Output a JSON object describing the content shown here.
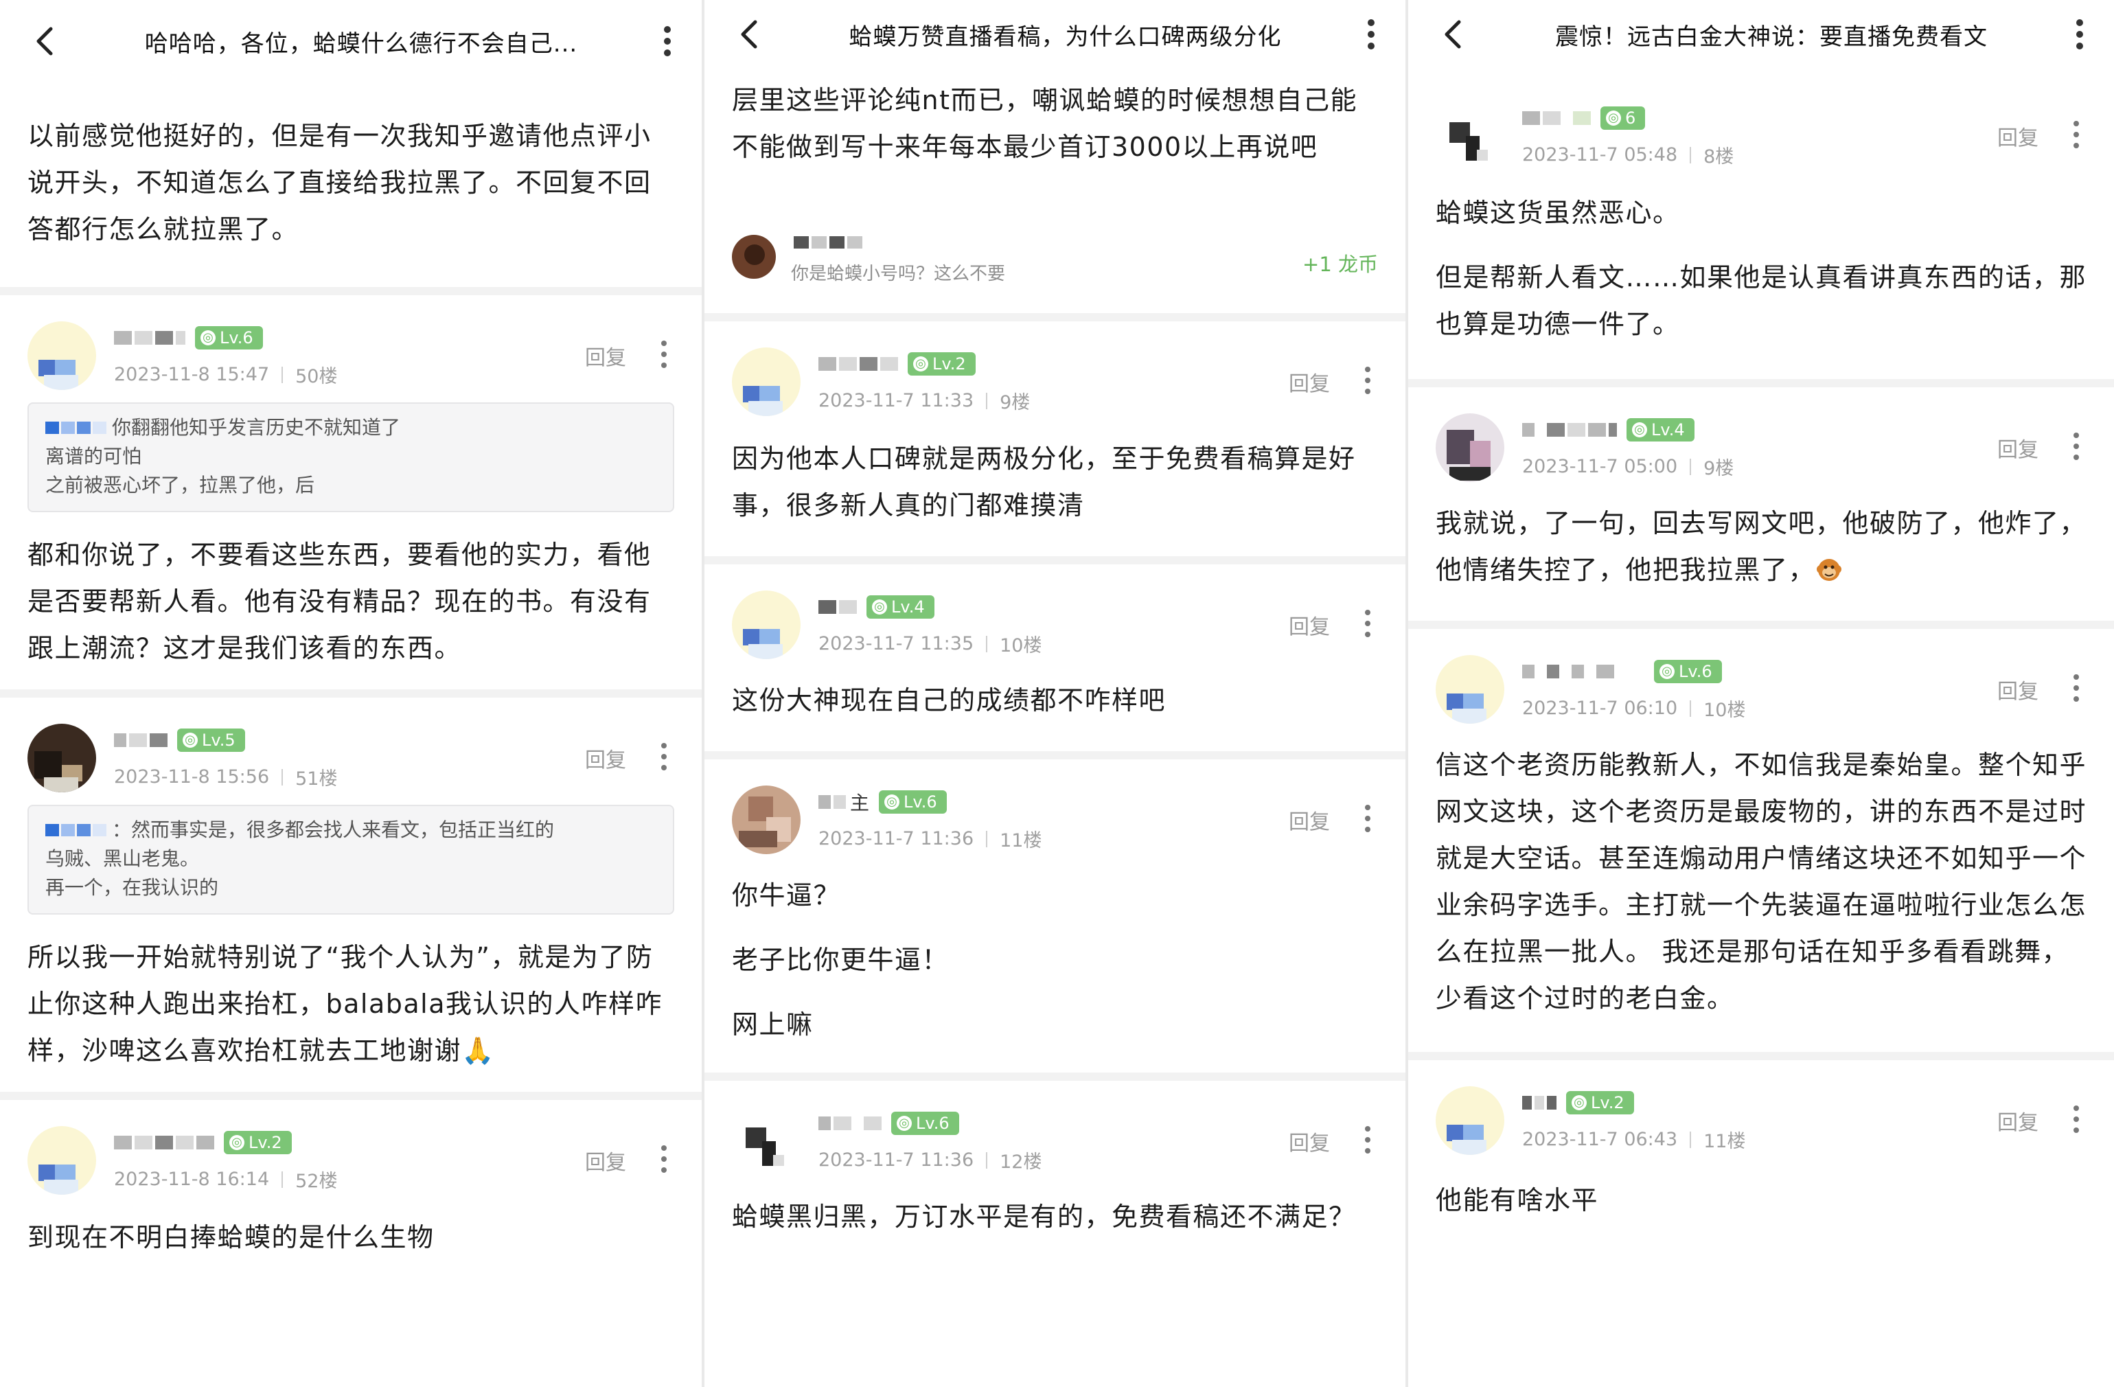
{
  "panels": [
    {
      "title": "哈哈哈，各位，蛤蟆什么德行不会自己...",
      "post_paragraphs": [
        "以前感觉他挺好的，但是有一次我知乎邀请他点评小说开头，不知道怎么了直接给我拉黑了。不回复不回答都行怎么就拉黑了。"
      ],
      "comments": [
        {
          "level": "Lv.6",
          "date": "2023-11-8 15:47",
          "floor": "50楼",
          "reply": "回复",
          "quote": {
            "first": "你翻翻他知乎发言历史不就知道了",
            "lines": [
              "离谱的可怕",
              "之前被恶心坏了，拉黑了他，后"
            ]
          },
          "paragraphs": [
            "都和你说了，不要看这些东西，要看他的实力，看他是否要帮新人看。他有没有精品？现在的书。有没有跟上潮流？这才是我们该看的东西。"
          ]
        },
        {
          "level": "Lv.5",
          "date": "2023-11-8 15:56",
          "floor": "51楼",
          "reply": "回复",
          "quote": {
            "first": "：然而事实是，很多都会找人来看文，包括正当红的",
            "lines": [
              "乌贼、黑山老鬼。",
              "再一个，在我认识的"
            ]
          },
          "paragraphs": [
            "所以我一开始就特别说了“我个人认为”，就是为了防止你这种人跑出来抬杠，balabala我认识的人咋样咋样，沙啤这么喜欢抬杠就去工地谢谢🙏"
          ]
        },
        {
          "level": "Lv.2",
          "date": "2023-11-8 16:14",
          "floor": "52楼",
          "reply": "回复",
          "paragraphs": [
            "到现在不明白捧蛤蟆的是什么生物"
          ]
        }
      ]
    },
    {
      "title": "蛤蟆万赞直播看稿，为什么口碑两级分化",
      "prev_tail": [
        "层里这些评论纯nt而已，嘲讽蛤蟆的时候想想自己能不能做到写十来年每本最少首订3000以上再说吧"
      ],
      "sub_reply": {
        "text": "你是蛤蟆小号吗？这么不要",
        "coin": "+1 龙币"
      },
      "comments": [
        {
          "level": "Lv.2",
          "date": "2023-11-7 11:33",
          "floor": "9楼",
          "reply": "回复",
          "paragraphs": [
            "因为他本人口碑就是两极分化，至于免费看稿算是好事，很多新人真的门都难摸清"
          ]
        },
        {
          "level": "Lv.4",
          "date": "2023-11-7 11:35",
          "floor": "10楼",
          "reply": "回复",
          "paragraphs": [
            "这份大神现在自己的成绩都不咋样吧"
          ]
        },
        {
          "level": "Lv.6",
          "name_suffix": "主",
          "date": "2023-11-7 11:36",
          "floor": "11楼",
          "reply": "回复",
          "paragraphs": [
            "你牛逼？",
            "老子比你更牛逼！",
            "网上嘛"
          ]
        },
        {
          "level": "Lv.6",
          "date": "2023-11-7 11:36",
          "floor": "12楼",
          "reply": "回复",
          "paragraphs": [
            "蛤蟆黑归黑，万订水平是有的，免费看稿还不满足？"
          ]
        }
      ]
    },
    {
      "title": "震惊！远古白金大神说：要直播免费看文",
      "comments": [
        {
          "level": "6",
          "date": "2023-11-7 05:48",
          "floor": "8楼",
          "reply": "回复",
          "paragraphs": [
            "蛤蟆这货虽然恶心。",
            "但是帮新人看文……如果他是认真看讲真东西的话，那也算是功德一件了。"
          ]
        },
        {
          "level": "Lv.4",
          "date": "2023-11-7 05:00",
          "floor": "9楼",
          "reply": "回复",
          "paragraphs": [
            "我就说，了一句，回去写网文吧，他破防了，他炸了，他情绪失控了，他把我拉黑了，"
          ]
        },
        {
          "level": "Lv.6",
          "date": "2023-11-7 06:10",
          "floor": "10楼",
          "reply": "回复",
          "paragraphs": [
            "信这个老资历能教新人，不如信我是秦始皇。整个知乎网文这块，这个老资历是最废物的，讲的东西不是过时就是大空话。甚至连煽动用户情绪这块还不如知乎一个业余码字选手。主打就一个先装逼在逼啦啦行业怎么怎么在拉黑一批人。 我还是那句话在知乎多看看跳舞，少看这个过时的老白金。"
          ]
        },
        {
          "level": "Lv.2",
          "date": "2023-11-7 06:43",
          "floor": "11楼",
          "reply": "回复",
          "paragraphs": [
            "他能有啥水平"
          ]
        }
      ]
    }
  ],
  "icons": {
    "back": "chevron-left-icon",
    "more": "more-vertical-icon",
    "level": "level-badge-icon",
    "emoji": "monkey-emoji-icon"
  },
  "colors": {
    "level_badge": "#7cc576",
    "coin_text": "#64b55a",
    "meta_text": "#a0a0a0"
  }
}
